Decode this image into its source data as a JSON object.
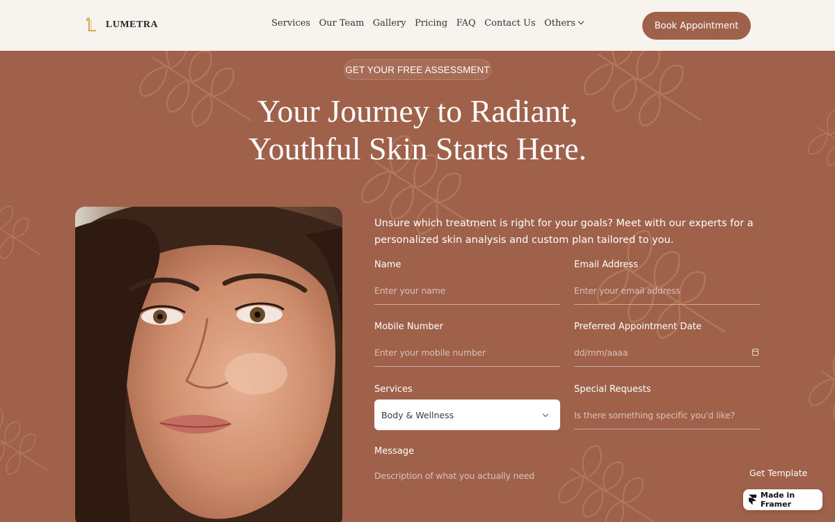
{
  "brand": {
    "name": "LUMETRA"
  },
  "nav": {
    "items": [
      "Services",
      "Our Team",
      "Gallery",
      "Pricing",
      "FAQ",
      "Contact Us",
      "Others"
    ],
    "cta": "Book Appointment"
  },
  "hero": {
    "eyebrow": "GET YOUR FREE ASSESSMENT",
    "title_line1": "Your Journey to Radiant,",
    "title_line2": "Youthful Skin Starts Here."
  },
  "form": {
    "intro": "Unsure which treatment is right for your goals? Meet with our experts for a personalized skin analysis and custom plan tailored to you.",
    "name": {
      "label": "Name",
      "placeholder": "Enter your name"
    },
    "email": {
      "label": "Email Address",
      "placeholder": "Enter your email address"
    },
    "mobile": {
      "label": "Mobile Number",
      "placeholder": "Enter your mobile number"
    },
    "date": {
      "label": "Preferred Appointment Date",
      "placeholder": "dd/mm/aaaa"
    },
    "services": {
      "label": "Services",
      "value": "Body & Wellness"
    },
    "requests": {
      "label": "Special Requests",
      "placeholder": "Is there something specific you'd like?"
    },
    "message": {
      "label": "Message",
      "placeholder": "Description of what you actually need"
    }
  },
  "footer": {
    "get_template": "Get Template",
    "framer_badge": "Made in Framer"
  },
  "colors": {
    "accent": "#A0614A",
    "header_bg": "#F7F4F0",
    "logo_gold": "#D9A54A"
  }
}
